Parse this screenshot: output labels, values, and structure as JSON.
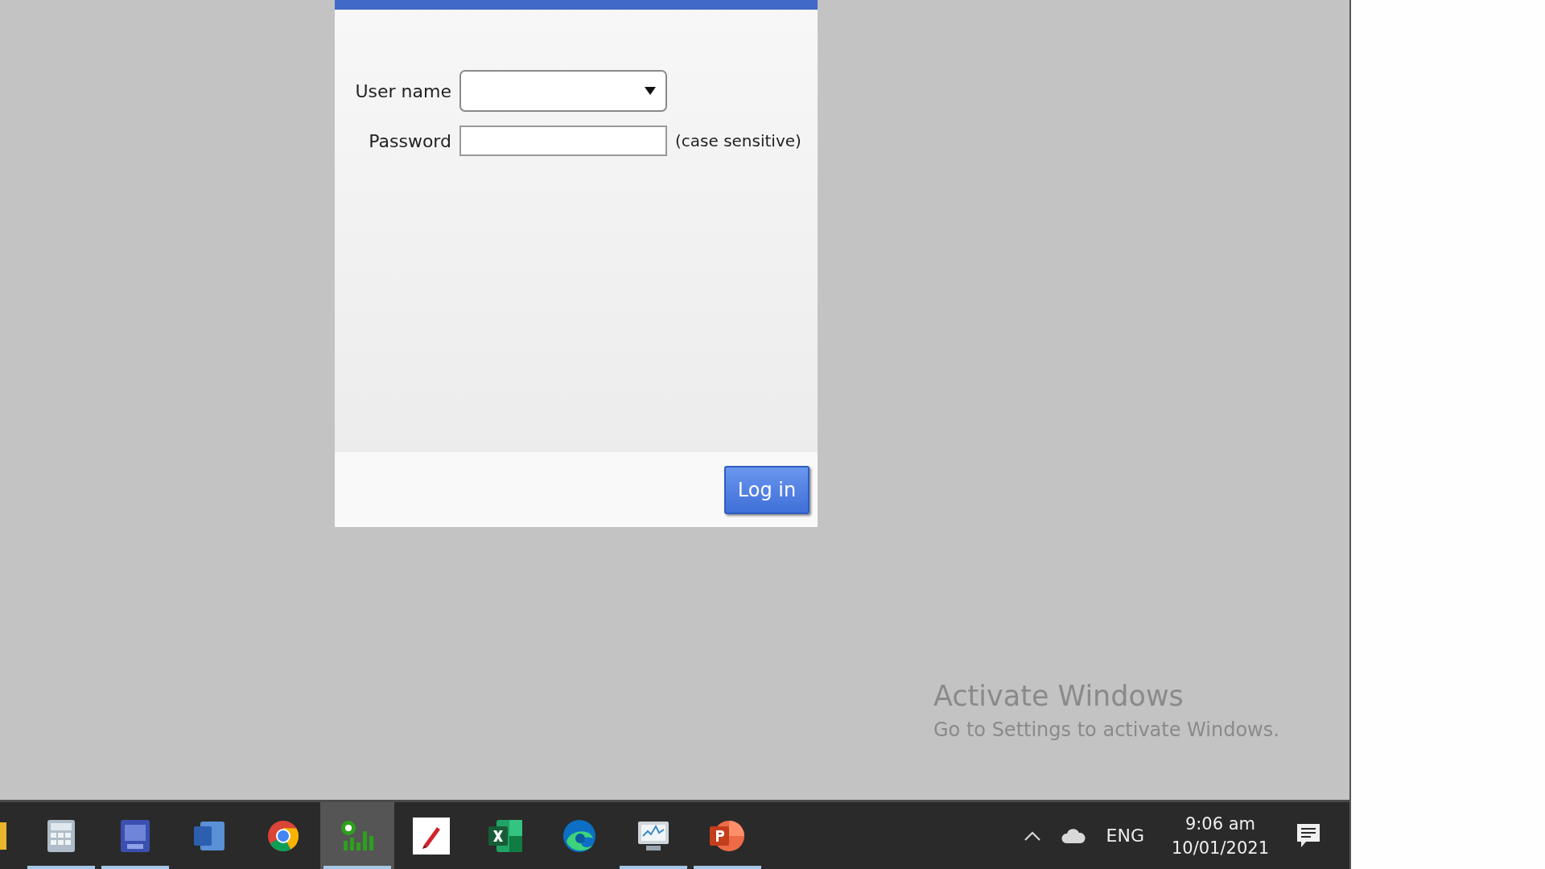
{
  "dialog": {
    "fields": [
      {
        "kind": "dropdown",
        "label": "User name"
      },
      {
        "kind": "password",
        "label": "Password",
        "note": "(case sensitive)"
      }
    ],
    "button": "Log in"
  },
  "activation": {
    "title": "Activate Windows",
    "message": "Go to Settings to activate Windows."
  },
  "taskbar": {
    "apps": [
      {
        "running": false,
        "selected": false
      },
      {
        "running": true,
        "selected": false
      },
      {
        "running": true,
        "selected": false
      },
      {
        "running": false,
        "selected": false
      },
      {
        "running": false,
        "selected": false
      },
      {
        "running": true,
        "selected": true
      },
      {
        "running": false,
        "selected": false
      },
      {
        "running": false,
        "selected": false
      },
      {
        "running": false,
        "selected": false
      },
      {
        "running": true,
        "selected": false
      },
      {
        "running": true,
        "selected": false
      }
    ],
    "tray": {
      "language": "ENG",
      "time": "9:06 am",
      "date": "10/01/2021"
    }
  }
}
